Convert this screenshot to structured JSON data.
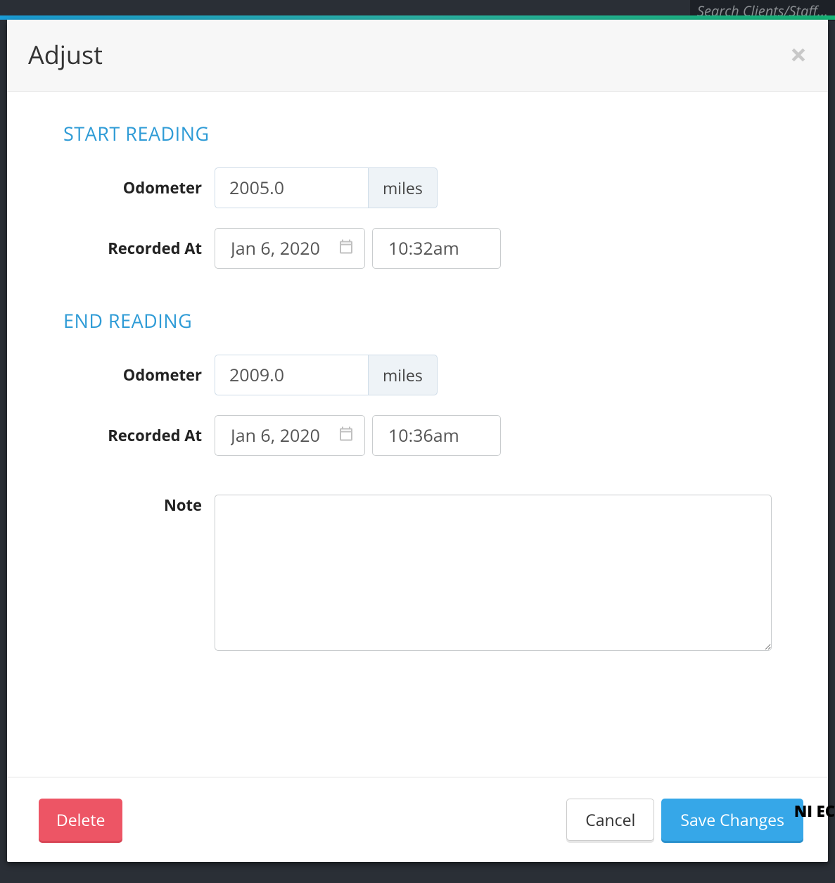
{
  "background": {
    "search_placeholder": "Search Clients/Staff...",
    "side_text": "NI\nEC"
  },
  "modal": {
    "title": "Adjust",
    "sections": {
      "start": {
        "heading": "START READING",
        "odometer_label": "Odometer",
        "odometer_value": "2005.0",
        "odometer_unit": "miles",
        "recorded_label": "Recorded At",
        "date_value": "Jan 6, 2020",
        "time_value": "10:32am"
      },
      "end": {
        "heading": "END READING",
        "odometer_label": "Odometer",
        "odometer_value": "2009.0",
        "odometer_unit": "miles",
        "recorded_label": "Recorded At",
        "date_value": "Jan 6, 2020",
        "time_value": "10:36am"
      },
      "note": {
        "label": "Note",
        "value": ""
      }
    },
    "footer": {
      "delete_label": "Delete",
      "cancel_label": "Cancel",
      "save_label": "Save Changes"
    }
  }
}
